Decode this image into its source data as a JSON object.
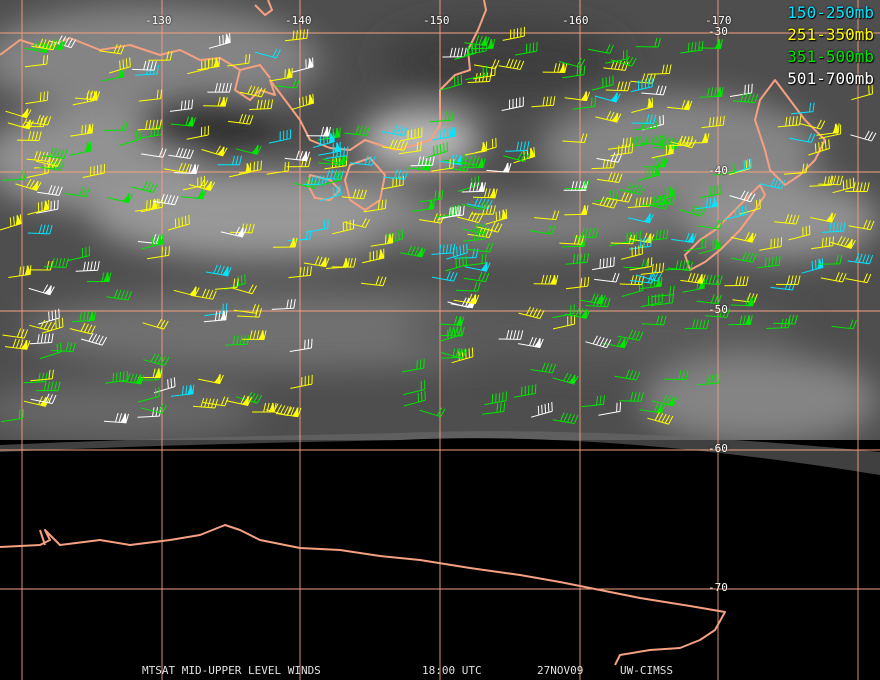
{
  "legend": [
    {
      "label": "150-250mb",
      "color": "#00e5ff"
    },
    {
      "label": "251-350mb",
      "color": "#ffff00"
    },
    {
      "label": "351-500mb",
      "color": "#00e600"
    },
    {
      "label": "501-700mb",
      "color": "#ffffff"
    }
  ],
  "lon_labels": [
    "-130",
    "-140",
    "-150",
    "-160",
    "-170"
  ],
  "lat_labels": [
    "-30",
    "-40",
    "-50",
    "-60",
    "-70"
  ],
  "footer": {
    "product": "MTSAT MID-UPPER LEVEL WINDS",
    "time": "18:00 UTC",
    "date": "27NOV09",
    "source": "UW-CIMSS"
  },
  "colors": {
    "grid": "#f5a080",
    "coastline": "#f5a080",
    "space": "#000000"
  }
}
